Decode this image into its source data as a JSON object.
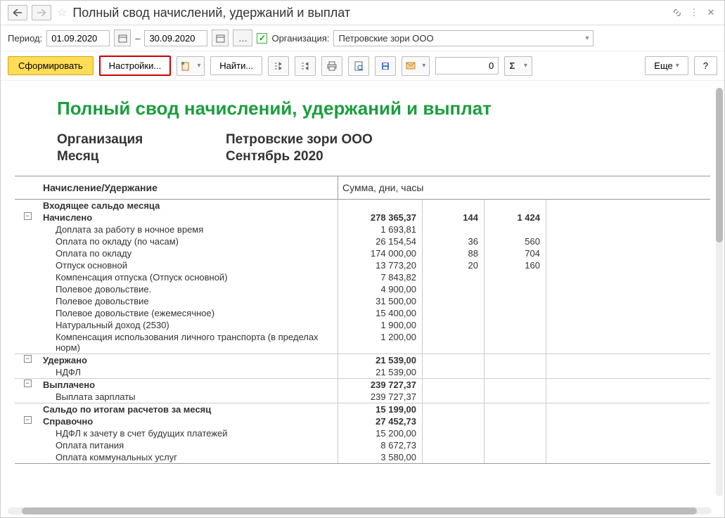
{
  "title": "Полный свод начислений, удержаний и выплат",
  "period": {
    "label": "Период:",
    "from": "01.09.2020",
    "dash": "–",
    "to": "30.09.2020"
  },
  "org": {
    "label": "Организация:",
    "value": "Петровские зори ООО"
  },
  "toolbar": {
    "generate": "Сформировать",
    "settings": "Настройки...",
    "find": "Найти...",
    "num_value": "0",
    "more": "Еще",
    "help": "?"
  },
  "report": {
    "title": "Полный свод начислений, удержаний и выплат",
    "org_label": "Организация",
    "org_value": "Петровские зори ООО",
    "month_label": "Месяц",
    "month_value": "Сентябрь 2020",
    "header_left": "Начисление/Удержание",
    "header_right": "Сумма, дни, часы",
    "rows": [
      {
        "name": "Входящее сальдо месяца",
        "sum": "",
        "days": "",
        "hours": "",
        "bold": true,
        "toggle": false,
        "indent": false
      },
      {
        "name": "Начислено",
        "sum": "278 365,37",
        "days": "144",
        "hours": "1 424",
        "bold": true,
        "toggle": true,
        "indent": false
      },
      {
        "name": "Доплата за работу в ночное время",
        "sum": "1 693,81",
        "days": "",
        "hours": "",
        "bold": false,
        "toggle": false,
        "indent": true
      },
      {
        "name": "Оплата по окладу (по часам)",
        "sum": "26 154,54",
        "days": "36",
        "hours": "560",
        "bold": false,
        "toggle": false,
        "indent": true
      },
      {
        "name": "Оплата по окладу",
        "sum": "174 000,00",
        "days": "88",
        "hours": "704",
        "bold": false,
        "toggle": false,
        "indent": true
      },
      {
        "name": "Отпуск основной",
        "sum": "13 773,20",
        "days": "20",
        "hours": "160",
        "bold": false,
        "toggle": false,
        "indent": true
      },
      {
        "name": "Компенсация отпуска (Отпуск основной)",
        "sum": "7 843,82",
        "days": "",
        "hours": "",
        "bold": false,
        "toggle": false,
        "indent": true
      },
      {
        "name": "Полевое довольствие.",
        "sum": "4 900,00",
        "days": "",
        "hours": "",
        "bold": false,
        "toggle": false,
        "indent": true
      },
      {
        "name": "Полевое довольствие",
        "sum": "31 500,00",
        "days": "",
        "hours": "",
        "bold": false,
        "toggle": false,
        "indent": true
      },
      {
        "name": "Полевое довольствие (ежемесячное)",
        "sum": "15 400,00",
        "days": "",
        "hours": "",
        "bold": false,
        "toggle": false,
        "indent": true
      },
      {
        "name": "Натуральный доход (2530)",
        "sum": "1 900,00",
        "days": "",
        "hours": "",
        "bold": false,
        "toggle": false,
        "indent": true
      },
      {
        "name": "Компенсация использования личного транспорта (в пределах норм)",
        "sum": "1 200,00",
        "days": "",
        "hours": "",
        "bold": false,
        "toggle": false,
        "indent": true
      },
      {
        "name": "Удержано",
        "sum": "21 539,00",
        "days": "",
        "hours": "",
        "bold": true,
        "toggle": true,
        "indent": false,
        "sep": true
      },
      {
        "name": "НДФЛ",
        "sum": "21 539,00",
        "days": "",
        "hours": "",
        "bold": false,
        "toggle": false,
        "indent": true
      },
      {
        "name": "Выплачено",
        "sum": "239 727,37",
        "days": "",
        "hours": "",
        "bold": true,
        "toggle": true,
        "indent": false,
        "sep": true
      },
      {
        "name": "Выплата зарплаты",
        "sum": "239 727,37",
        "days": "",
        "hours": "",
        "bold": false,
        "toggle": false,
        "indent": true
      },
      {
        "name": "Сальдо по итогам расчетов за месяц",
        "sum": "15 199,00",
        "days": "",
        "hours": "",
        "bold": true,
        "toggle": false,
        "indent": false,
        "sep": true
      },
      {
        "name": "Справочно",
        "sum": "27 452,73",
        "days": "",
        "hours": "",
        "bold": true,
        "toggle": true,
        "indent": false
      },
      {
        "name": "НДФЛ к зачету в счет будущих платежей",
        "sum": "15 200,00",
        "days": "",
        "hours": "",
        "bold": false,
        "toggle": false,
        "indent": true
      },
      {
        "name": "Оплата питания",
        "sum": "8 672,73",
        "days": "",
        "hours": "",
        "bold": false,
        "toggle": false,
        "indent": true
      },
      {
        "name": "Оплата коммунальных услуг",
        "sum": "3 580,00",
        "days": "",
        "hours": "",
        "bold": false,
        "toggle": false,
        "indent": true
      }
    ]
  }
}
